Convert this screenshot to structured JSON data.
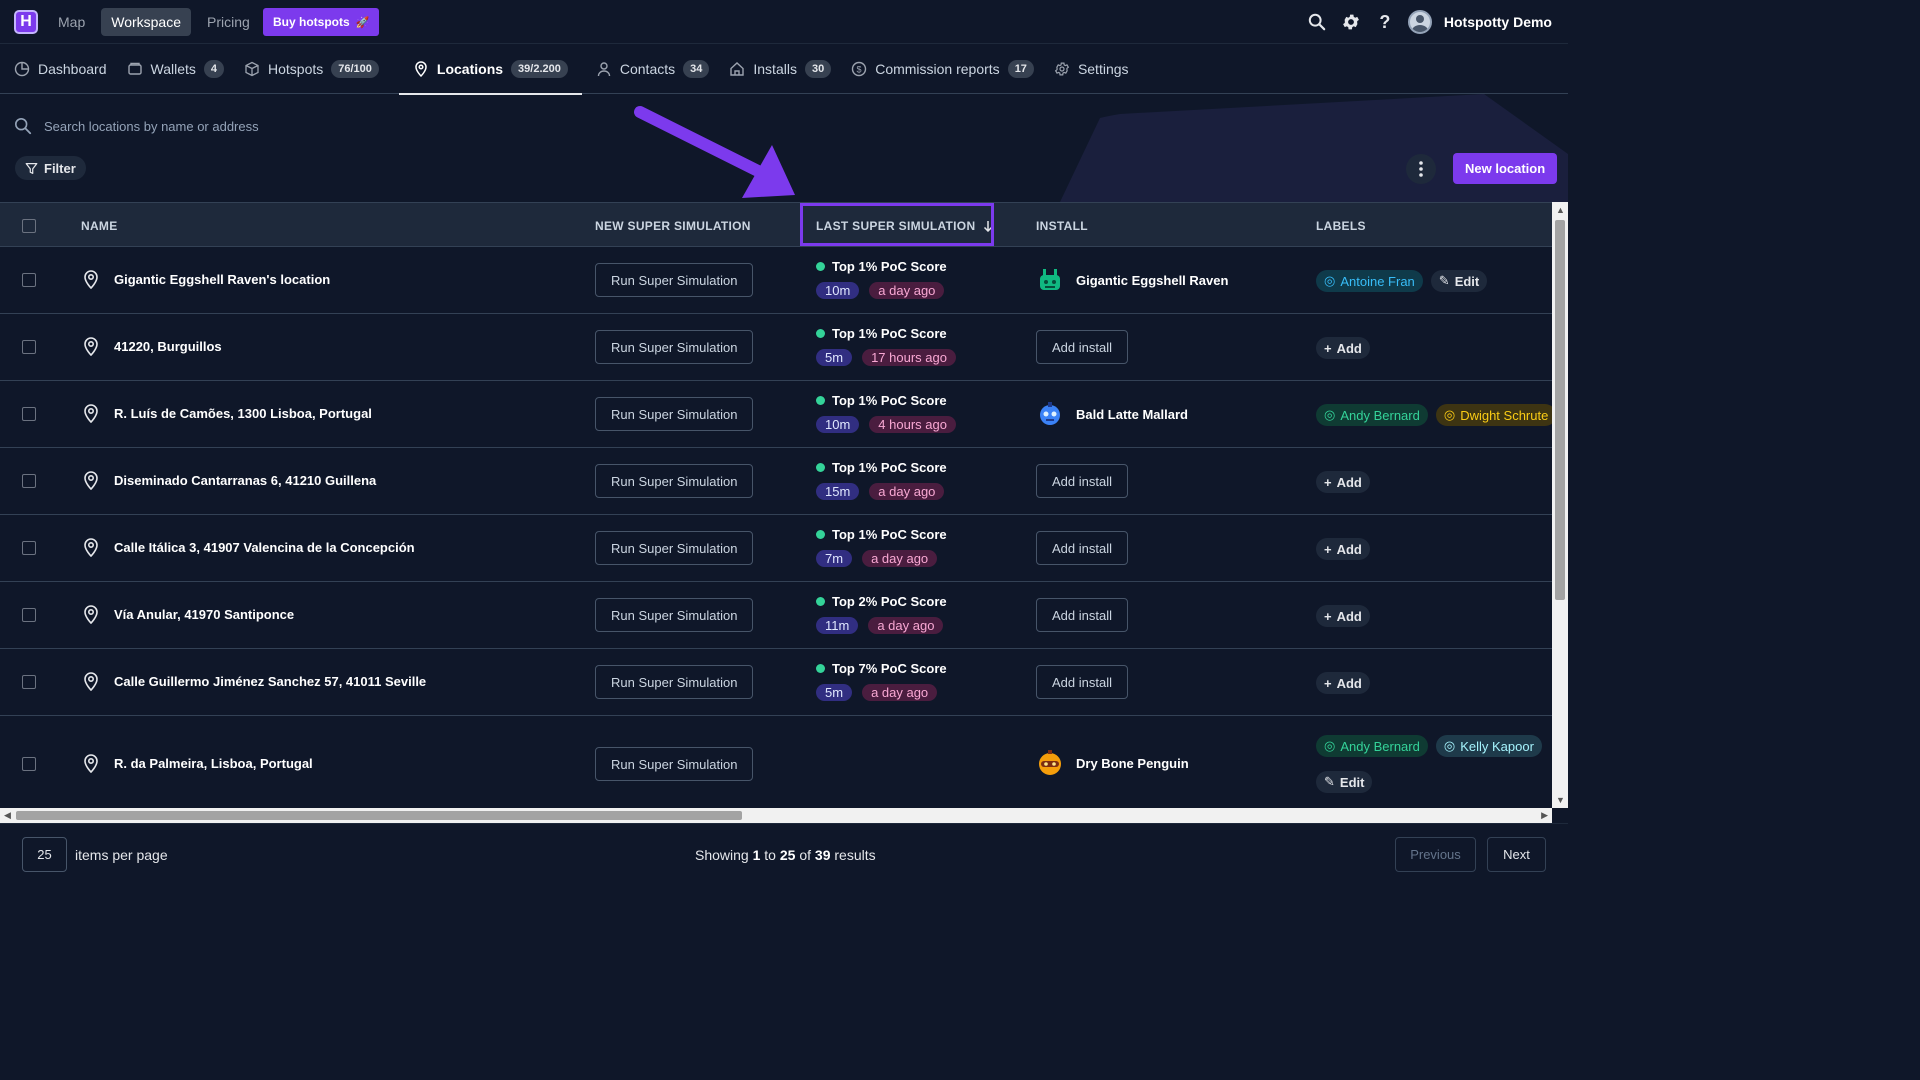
{
  "topbar": {
    "logo": "H",
    "nav": [
      "Map",
      "Workspace",
      "Pricing"
    ],
    "active_nav": "Workspace",
    "buy_label": "Buy hotspots",
    "user_name": "Hotspotty Demo"
  },
  "tabs": [
    {
      "label": "Dashboard",
      "count": null
    },
    {
      "label": "Wallets",
      "count": "4"
    },
    {
      "label": "Hotspots",
      "count": "76/100"
    },
    {
      "label": "Locations",
      "count": "39/2.200",
      "active": true
    },
    {
      "label": "Contacts",
      "count": "34"
    },
    {
      "label": "Installs",
      "count": "30"
    },
    {
      "label": "Commission reports",
      "count": "17"
    },
    {
      "label": "Settings",
      "count": null
    }
  ],
  "search": {
    "placeholder": "Search locations by name or address"
  },
  "filter_label": "Filter",
  "new_location_label": "New location",
  "table": {
    "headers": {
      "name": "NAME",
      "new_sim": "NEW SUPER SIMULATION",
      "last_sim": "LAST SUPER SIMULATION",
      "install": "INSTALL",
      "labels": "LABELS"
    },
    "run_label": "Run Super Simulation",
    "add_install_label": "Add install",
    "add_label": "Add",
    "edit_label": "Edit",
    "rows": [
      {
        "name": "Gigantic Eggshell Raven's location",
        "score": "Top 1% PoC Score",
        "time": "10m",
        "ago": "a day ago",
        "install": "Gigantic Eggshell Raven",
        "labels": [
          "Antoine Fran"
        ],
        "action": "Edit"
      },
      {
        "name": "41220, Burguillos",
        "score": "Top 1% PoC Score",
        "time": "5m",
        "ago": "17 hours ago",
        "install": null,
        "labels": [],
        "action": "Add"
      },
      {
        "name": "R. Luís de Camões, 1300 Lisboa, Portugal",
        "score": "Top 1% PoC Score",
        "time": "10m",
        "ago": "4 hours ago",
        "install": "Bald Latte Mallard",
        "labels": [
          "Andy Bernard",
          "Dwight Schrute"
        ],
        "action": null
      },
      {
        "name": "Diseminado Cantarranas 6, 41210 Guillena",
        "score": "Top 1% PoC Score",
        "time": "15m",
        "ago": "a day ago",
        "install": null,
        "labels": [],
        "action": "Add"
      },
      {
        "name": "Calle Itálica 3, 41907 Valencina de la Concepción",
        "score": "Top 1% PoC Score",
        "time": "7m",
        "ago": "a day ago",
        "install": null,
        "labels": [],
        "action": "Add"
      },
      {
        "name": "Vía Anular, 41970 Santiponce",
        "score": "Top 2% PoC Score",
        "time": "11m",
        "ago": "a day ago",
        "install": null,
        "labels": [],
        "action": "Add"
      },
      {
        "name": "Calle Guillermo Jiménez Sanchez 57, 41011 Seville",
        "score": "Top 7% PoC Score",
        "time": "5m",
        "ago": "a day ago",
        "install": null,
        "labels": [],
        "action": "Add"
      },
      {
        "name": "R. da Palmeira, Lisboa, Portugal",
        "score": null,
        "time": null,
        "ago": null,
        "install": "Dry Bone Penguin",
        "labels": [
          "Andy Bernard",
          "Kelly Kapoor"
        ],
        "action": "Edit"
      }
    ]
  },
  "pagination": {
    "per_page": "25",
    "per_page_label": "items per page",
    "showing_prefix": "Showing",
    "from": "1",
    "to_word": "to",
    "to": "25",
    "of_word": "of",
    "total": "39",
    "results_word": "results",
    "prev_label": "Previous",
    "next_label": "Next"
  },
  "colors": {
    "accent": "#7c3aed",
    "background": "#0f1729",
    "header_bg": "#1e293b",
    "success": "#34d399"
  }
}
